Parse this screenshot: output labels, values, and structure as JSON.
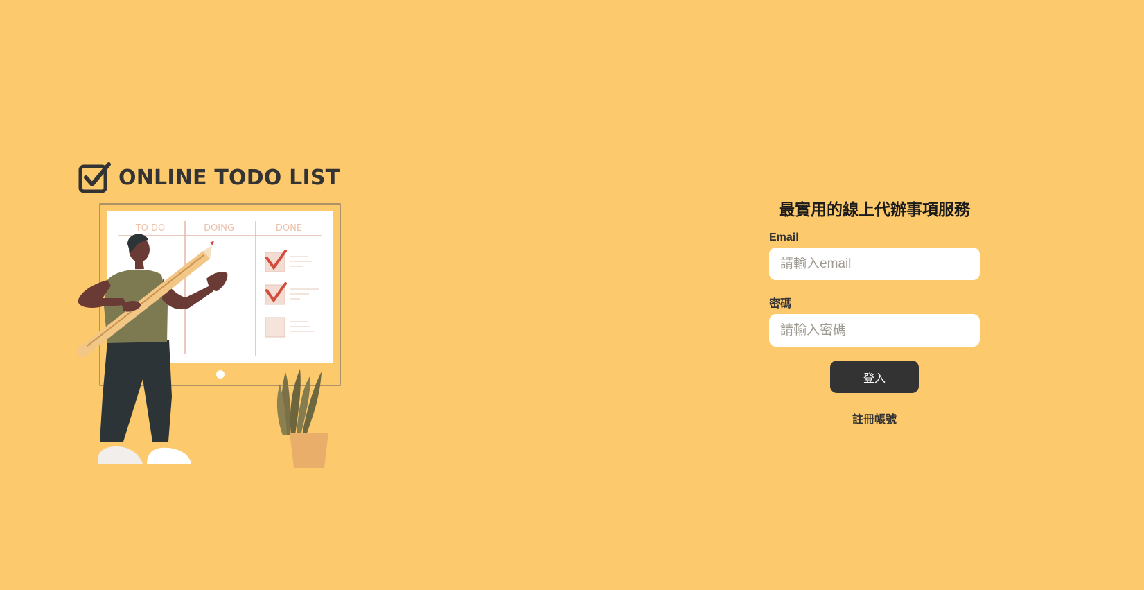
{
  "brand": {
    "logo_text": "ONLINE TODO LIST",
    "logo_icon": "checkbox-icon"
  },
  "illustration": {
    "board_columns": [
      "TO DO",
      "DOING",
      "DONE"
    ]
  },
  "login": {
    "title": "最實用的線上代辦事項服務",
    "email_label": "Email",
    "email_placeholder": "請輸入email",
    "password_label": "密碼",
    "password_placeholder": "請輸入密碼",
    "submit_label": "登入",
    "register_label": "註冊帳號"
  },
  "colors": {
    "background": "#FDC96D",
    "primary_dark": "#333333",
    "input_bg": "#FFFFFF"
  }
}
